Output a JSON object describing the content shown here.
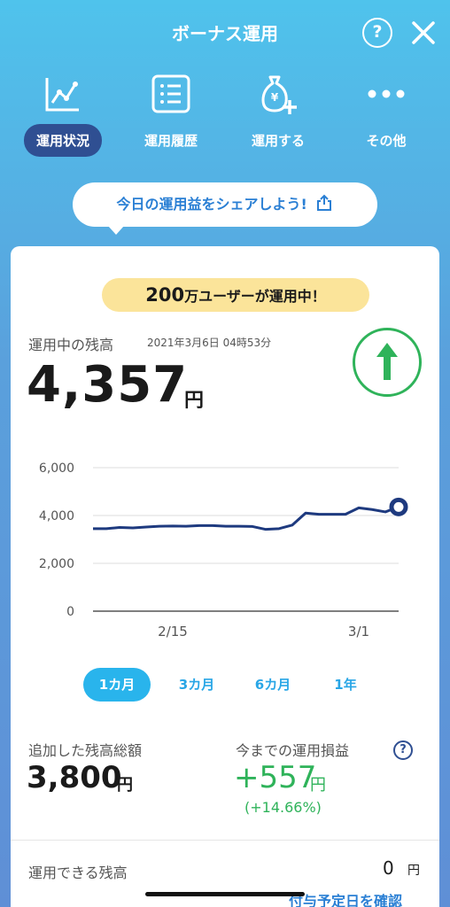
{
  "header": {
    "title": "ボーナス運用",
    "help_label": "?"
  },
  "nav": {
    "items": [
      {
        "label": "運用状況",
        "icon": "chart-line-icon",
        "active": true
      },
      {
        "label": "運用履歴",
        "icon": "list-icon",
        "active": false
      },
      {
        "label": "運用する",
        "icon": "money-bag-plus-icon",
        "active": false
      },
      {
        "label": "その他",
        "icon": "more-dots-icon",
        "active": false
      }
    ]
  },
  "share": {
    "label": "今日の運用益をシェアしよう!"
  },
  "card": {
    "banner_num": "200",
    "banner_text": "万ユーザーが運用中！",
    "balance_label": "運用中の残高",
    "timestamp": "2021年3月6日 04時53分",
    "balance_value": "4,357",
    "balance_unit": "円",
    "trend": "up"
  },
  "chart_data": {
    "type": "line",
    "y_ticks": [
      "6,000",
      "4,000",
      "2,000",
      "0"
    ],
    "x_ticks": [
      "2/15",
      "3/1"
    ],
    "ylim": [
      0,
      6000
    ],
    "x_labeled_days": {
      "2/15": 6,
      "3/1": 20
    },
    "series": [
      {
        "color": "#1e3a7f",
        "x": [
          0,
          1,
          2,
          3,
          4,
          5,
          6,
          7,
          8,
          9,
          10,
          11,
          12,
          13,
          14,
          15,
          16,
          17,
          18,
          19,
          20,
          21,
          22,
          23
        ],
        "values": [
          3450,
          3450,
          3500,
          3480,
          3520,
          3550,
          3560,
          3550,
          3580,
          3580,
          3550,
          3550,
          3540,
          3420,
          3450,
          3600,
          4100,
          4050,
          4050,
          4050,
          4320,
          4250,
          4150,
          4357
        ]
      }
    ]
  },
  "periods": [
    {
      "label": "1カ月",
      "active": true
    },
    {
      "label": "3カ月",
      "active": false
    },
    {
      "label": "6カ月",
      "active": false
    },
    {
      "label": "1年",
      "active": false
    }
  ],
  "stats": {
    "added_label": "追加した残高総額",
    "added_value": "3,800",
    "added_unit": "円",
    "pl_label": "今までの運用損益",
    "pl_value": "+557",
    "pl_unit": "円",
    "pl_percent": "(+14.66%)",
    "pl_help": "?"
  },
  "available": {
    "label": "運用できる残高",
    "value": "0",
    "unit": "円",
    "link": "付与予定日を確認"
  }
}
